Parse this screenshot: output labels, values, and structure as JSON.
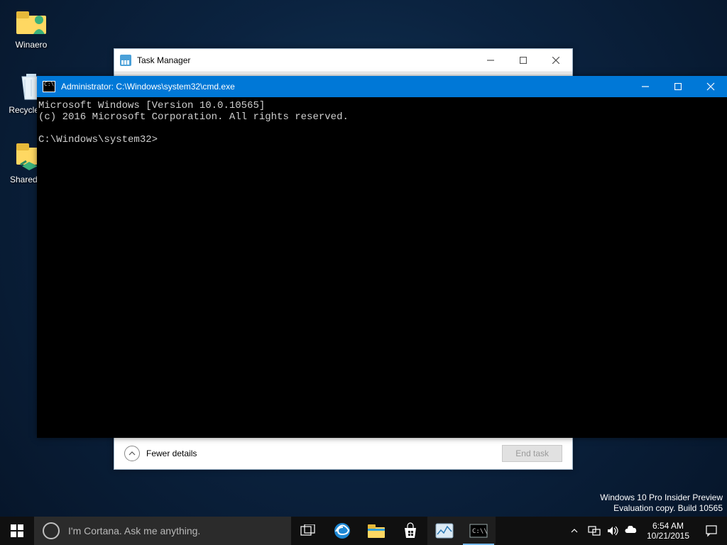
{
  "desktop": {
    "icons": [
      {
        "label": "Winaero"
      },
      {
        "label": "Recycle Bin"
      },
      {
        "label": "SharedFolder"
      }
    ]
  },
  "taskmgr": {
    "title": "Task Manager",
    "fewer": "Fewer details",
    "endtask": "End task"
  },
  "cmd": {
    "title": "Administrator: C:\\Windows\\system32\\cmd.exe",
    "line1": "Microsoft Windows [Version 10.0.10565]",
    "line2": "(c) 2016 Microsoft Corporation. All rights reserved.",
    "prompt": "C:\\Windows\\system32>"
  },
  "watermark": {
    "l1": "Windows 10 Pro Insider Preview",
    "l2": "Evaluation copy. Build 10565"
  },
  "taskbar": {
    "cortana_placeholder": "I'm Cortana. Ask me anything.",
    "time": "6:54 AM",
    "date": "10/21/2015"
  }
}
